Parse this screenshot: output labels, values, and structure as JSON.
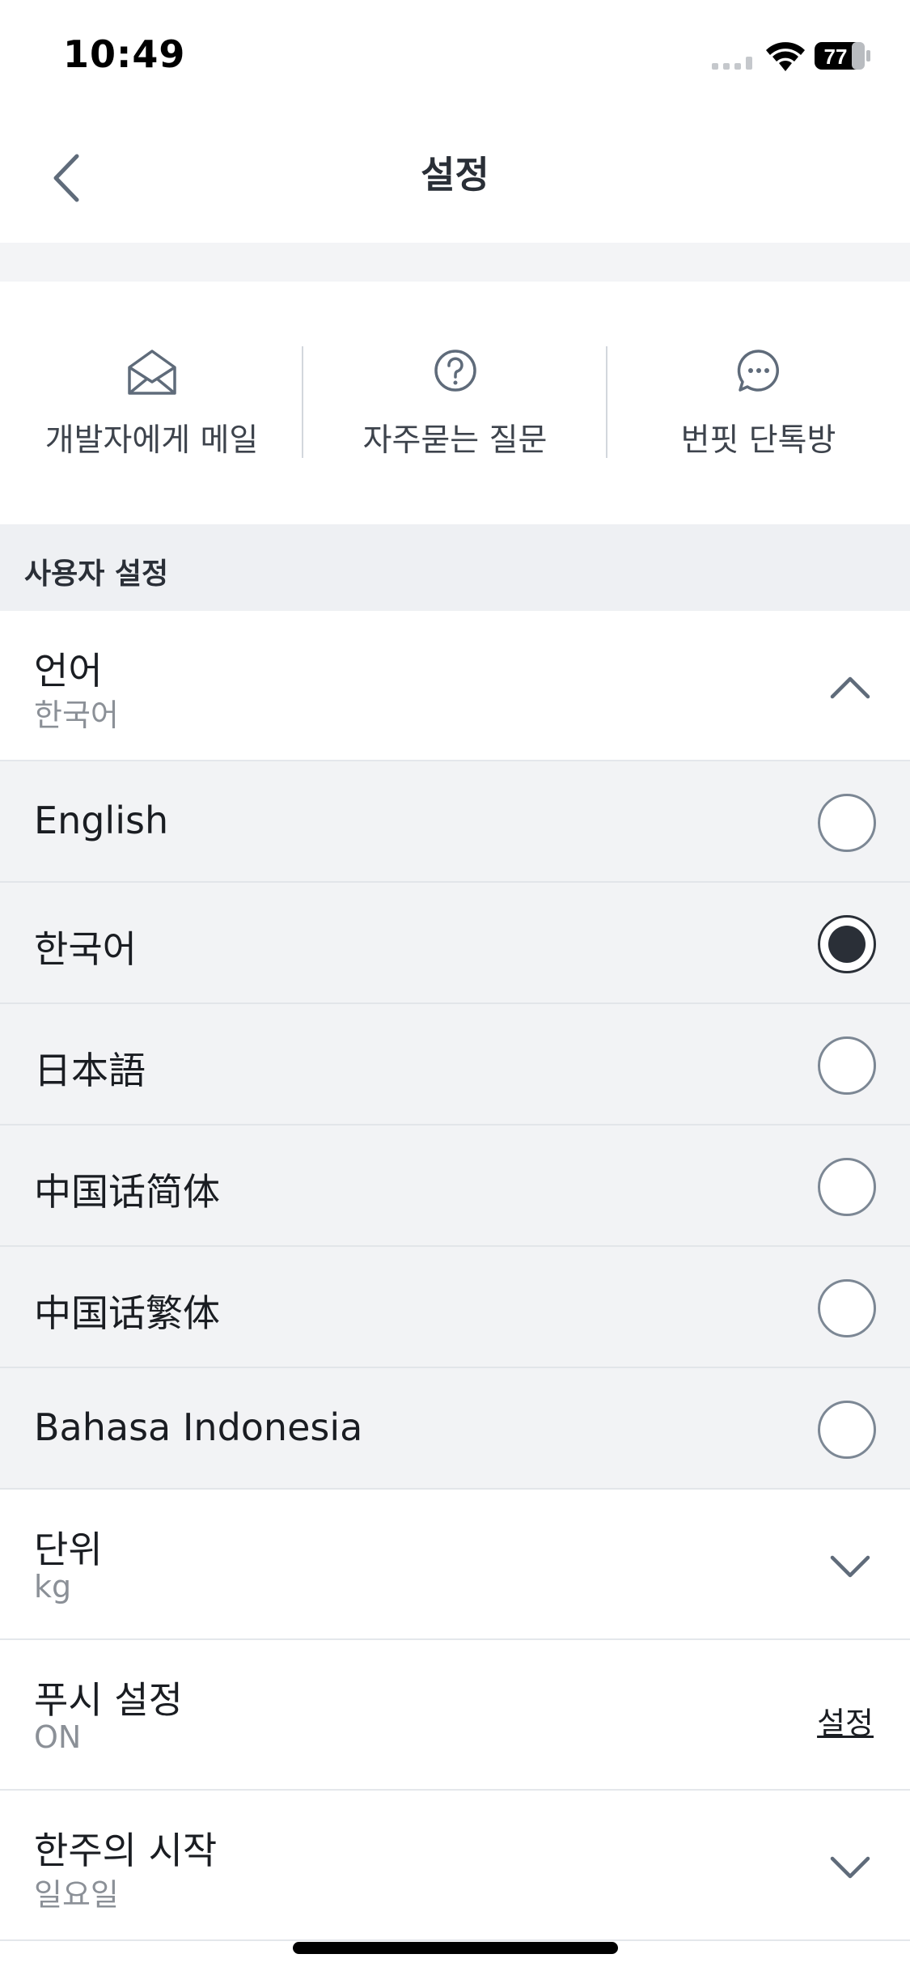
{
  "status_bar": {
    "time": "10:49",
    "battery": "77"
  },
  "nav": {
    "title": "설정",
    "back_icon": "chevron-left-icon"
  },
  "shortcuts": [
    {
      "label": "개발자에게 메일",
      "icon": "envelope-icon"
    },
    {
      "label": "자주묻는 질문",
      "icon": "question-circle-icon"
    },
    {
      "label": "번핏 단톡방",
      "icon": "chat-bubble-icon"
    }
  ],
  "section": {
    "title": "사용자 설정"
  },
  "language": {
    "label": "언어",
    "value": "한국어",
    "expanded": true,
    "options": [
      {
        "label": "English",
        "selected": false
      },
      {
        "label": "한국어",
        "selected": true
      },
      {
        "label": "日本語",
        "selected": false
      },
      {
        "label": "中国话简体",
        "selected": false
      },
      {
        "label": "中国话繁体",
        "selected": false
      },
      {
        "label": "Bahasa Indonesia",
        "selected": false
      }
    ]
  },
  "unit": {
    "label": "단위",
    "value": "kg"
  },
  "push": {
    "label": "푸시 설정",
    "value": "ON",
    "link": "설정"
  },
  "week_start": {
    "label": "한주의 시작",
    "value": "일요일"
  },
  "colors": {
    "accent": "#2a2f37",
    "radio_border": "#7c8794",
    "option_bg": "#f2f3f5",
    "section_bg": "#eef0f3"
  }
}
